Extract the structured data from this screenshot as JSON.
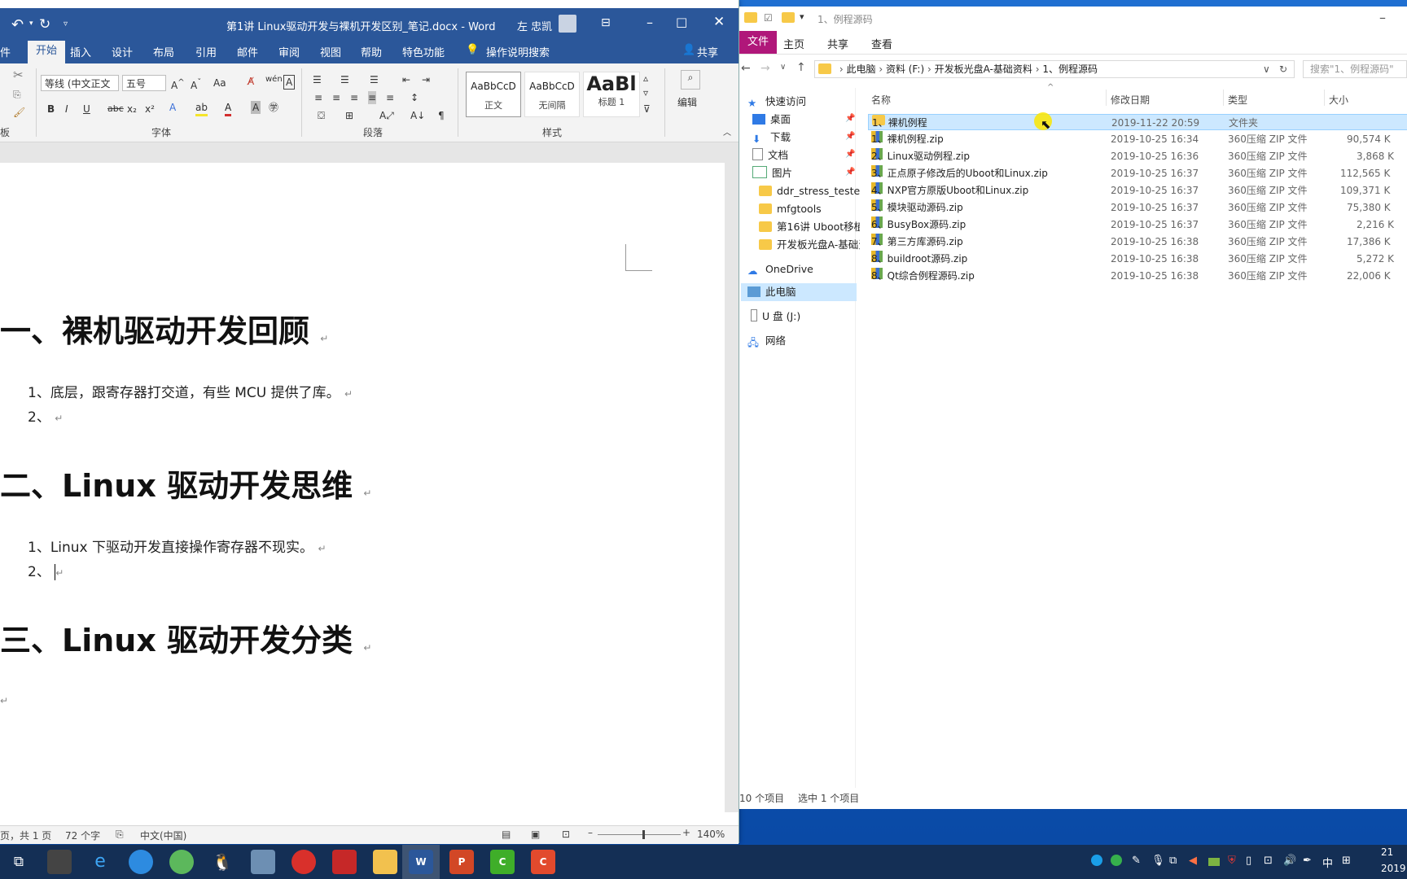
{
  "word": {
    "title": "第1讲 Linux驱动开发与裸机开发区别_笔记.docx  -  Word",
    "user": "左 忠凯",
    "tabs": [
      "件",
      "开始",
      "插入",
      "设计",
      "布局",
      "引用",
      "邮件",
      "审阅",
      "视图",
      "帮助",
      "特色功能"
    ],
    "tell_me": "操作说明搜索",
    "share": "共享",
    "ribbon": {
      "font_name": "等线 (中文正文",
      "font_size": "五号",
      "change_case": "Aa",
      "group_clipboard": "板",
      "group_font": "字体",
      "group_paragraph": "段落",
      "group_styles": "样式",
      "edit_label": "编辑",
      "styles": [
        {
          "preview": "AaBbCcD",
          "name": "正文"
        },
        {
          "preview": "AaBbCcD",
          "name": "无间隔"
        },
        {
          "preview": "AaBl",
          "name": "标题 1"
        }
      ]
    },
    "doc": {
      "h1": "一、裸机驱动开发回顾",
      "p1_1": "1、底层，跟寄存器打交道，有些 MCU 提供了库。",
      "p1_2": "2、",
      "h2": "二、Linux 驱动开发思维",
      "p2_1": "1、Linux 下驱动开发直接操作寄存器不现实。",
      "p2_2": "2、",
      "h3": "三、Linux 驱动开发分类",
      "para_mark": "↵"
    },
    "status": {
      "page": "页，共 1 页",
      "words": "72 个字",
      "lang": "中文(中国)",
      "zoom": "140%",
      "zoom_fraction": 0.55
    }
  },
  "explorer": {
    "title": "1、例程源码",
    "tabs": [
      "文件",
      "主页",
      "共享",
      "查看"
    ],
    "breadcrumb": [
      "此电脑",
      "资料 (F:)",
      "开发板光盘A-基础资料",
      "1、例程源码"
    ],
    "search_placeholder": "搜索\"1、例程源码\"",
    "nav": {
      "quick_access": "快速访问",
      "items": [
        "桌面",
        "下载",
        "文档",
        "图片",
        "ddr_stress_tester_",
        "mfgtools",
        "第16讲 Uboot移植",
        "开发板光盘A-基础资"
      ],
      "onedrive": "OneDrive",
      "this_pc": "此电脑",
      "usb": "U 盘 (J:)",
      "network": "网络"
    },
    "columns": {
      "name": "名称",
      "date": "修改日期",
      "type": "类型",
      "size": "大小"
    },
    "files": [
      {
        "name": "1、裸机例程",
        "date": "2019-11-22 20:59",
        "type": "文件夹",
        "size": ""
      },
      {
        "name": "1、裸机例程.zip",
        "date": "2019-10-25 16:34",
        "type": "360压缩 ZIP 文件",
        "size": "90,574 K"
      },
      {
        "name": "2、Linux驱动例程.zip",
        "date": "2019-10-25 16:36",
        "type": "360压缩 ZIP 文件",
        "size": "3,868 K"
      },
      {
        "name": "3、正点原子修改后的Uboot和Linux.zip",
        "date": "2019-10-25 16:37",
        "type": "360压缩 ZIP 文件",
        "size": "112,565 K"
      },
      {
        "name": "4、NXP官方原版Uboot和Linux.zip",
        "date": "2019-10-25 16:37",
        "type": "360压缩 ZIP 文件",
        "size": "109,371 K"
      },
      {
        "name": "5、模块驱动源码.zip",
        "date": "2019-10-25 16:37",
        "type": "360压缩 ZIP 文件",
        "size": "75,380 K"
      },
      {
        "name": "6、BusyBox源码.zip",
        "date": "2019-10-25 16:37",
        "type": "360压缩 ZIP 文件",
        "size": "2,216 K"
      },
      {
        "name": "7、第三方库源码.zip",
        "date": "2019-10-25 16:38",
        "type": "360压缩 ZIP 文件",
        "size": "17,386 K"
      },
      {
        "name": "8、buildroot源码.zip",
        "date": "2019-10-25 16:38",
        "type": "360压缩 ZIP 文件",
        "size": "5,272 K"
      },
      {
        "name": "8、Qt综合例程源码.zip",
        "date": "2019-10-25 16:38",
        "type": "360压缩 ZIP 文件",
        "size": "22,006 K"
      }
    ],
    "status": {
      "count": "10 个项目",
      "selected": "选中 1 个项目"
    }
  },
  "taskbar": {
    "ime": "中",
    "time": "21",
    "date": "2019"
  }
}
